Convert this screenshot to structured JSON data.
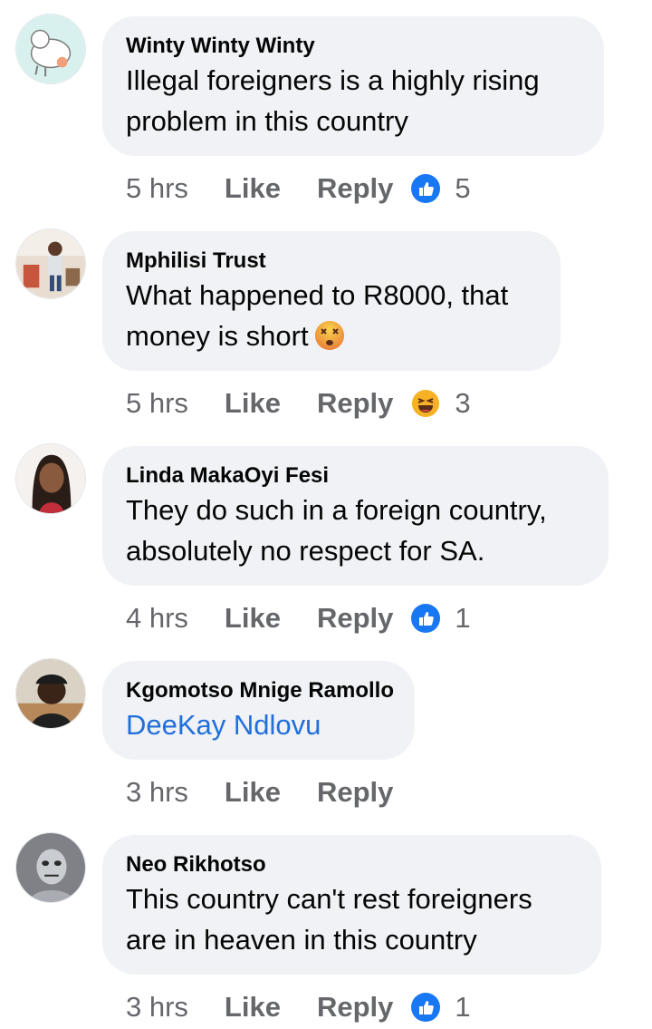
{
  "comments": [
    {
      "author": "Winty Winty Winty",
      "lines": [
        "Illegal foreigners is a highly rising",
        "problem in this country"
      ],
      "time": "5 hrs",
      "like": "Like",
      "reply": "Reply",
      "reaction": "like",
      "count": "5"
    },
    {
      "author": "Mphilisi Trust",
      "lines": [
        "What happened to R8000, that",
        "money is short"
      ],
      "inline_emoji": "dizzy-face-emoji",
      "time": "5 hrs",
      "like": "Like",
      "reply": "Reply",
      "reaction": "haha",
      "count": "3"
    },
    {
      "author": "Linda MakaOyi Fesi",
      "lines": [
        "They do such in a foreign country,",
        "absolutely no respect for SA."
      ],
      "time": "4 hrs",
      "like": "Like",
      "reply": "Reply",
      "reaction": "like",
      "count": "1"
    },
    {
      "author": "Kgomotso Mnige Ramollo",
      "lines": [
        "DeeKay Ndlovu"
      ],
      "time": "3 hrs",
      "like": "Like",
      "reply": "Reply"
    },
    {
      "author": "Neo Rikhotso",
      "lines": [
        "This country can't rest foreigners",
        "are in heaven in this country"
      ],
      "time": "3 hrs",
      "like": "Like",
      "reply": "Reply",
      "reaction": "like",
      "count": "1"
    }
  ],
  "colors": {
    "bubble": "#f0f2f5",
    "meta": "#65676b",
    "mention": "#216fdb",
    "like_reaction": "#1877f2",
    "haha_reaction": "#f7b125"
  }
}
